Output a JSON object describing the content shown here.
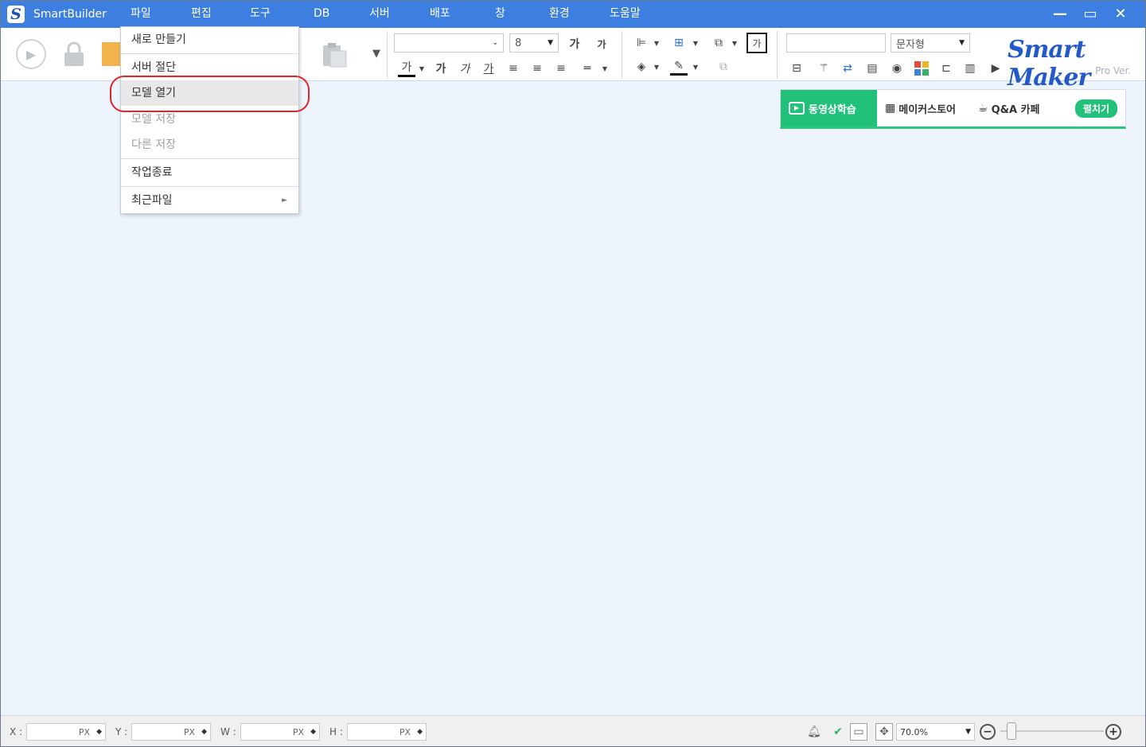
{
  "app": {
    "title": "SmartBuilder",
    "logo_letter": "S"
  },
  "menus": [
    "파일",
    "편집",
    "도구",
    "DB",
    "서버",
    "배포",
    "창",
    "환경",
    "도움말"
  ],
  "window_controls": {
    "minimize": "—",
    "maximize": "▭",
    "close": "✕"
  },
  "toolbar": {
    "font_size": "8",
    "bold_label": "가",
    "superscript_label": "가",
    "text_color_label": "가",
    "bold2": "가",
    "italic": "가",
    "underline": "가",
    "box_text": "가",
    "type_select": "문자형",
    "font_name": "",
    "name_field": ""
  },
  "brand": {
    "logo": "Smart Maker",
    "sub": "Pro Ver."
  },
  "banner": {
    "video": "동영상학습",
    "store": "메이커스토어",
    "qa": "Q&A 카페",
    "patch": "펼치기"
  },
  "file_menu": {
    "items": [
      {
        "label": "새로 만들기",
        "enabled": true
      },
      {
        "label": "서버 절단",
        "enabled": true
      },
      {
        "label": "모델 열기",
        "enabled": true,
        "hover": true
      },
      {
        "label": "모델 저장",
        "enabled": false
      },
      {
        "label": "다른 저장",
        "enabled": false
      },
      {
        "label": "작업종료",
        "enabled": true
      },
      {
        "label": "최근파일",
        "enabled": true,
        "submenu": true
      }
    ]
  },
  "statusbar": {
    "x_label": "X :",
    "y_label": "Y :",
    "w_label": "W :",
    "h_label": "H :",
    "unit": "PX",
    "zoom": "70.0%"
  },
  "colors": {
    "titlebar": "#3d7fe0",
    "canvas": "#edf4fc",
    "accent_green": "#22c17a",
    "highlight_red": "#e0262a"
  }
}
